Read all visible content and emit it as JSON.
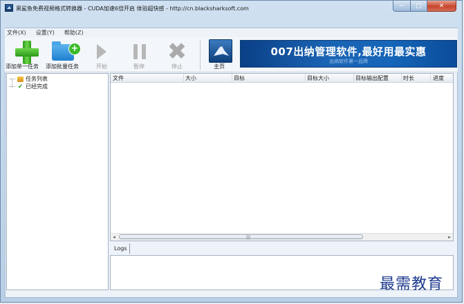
{
  "window": {
    "title": "黑鲨鱼免费视频格式转换器 - CUDA加速6倍开启 体验超快感 - http://cn.blacksharksoft.com",
    "buttons": {
      "minimize": "─",
      "maximize": "□",
      "close": "✕"
    }
  },
  "menu": {
    "items": [
      "文件(X)",
      "设置(Y)",
      "帮助(Z)"
    ]
  },
  "toolbar": {
    "add_single": "添加单一任务",
    "add_batch": "添加批量任务",
    "start": "开始",
    "pause": "暂停",
    "stop": "停止",
    "home": "主页"
  },
  "banner": {
    "main": "007出纳管理软件,最好用最实惠",
    "sub": "出纳软件第一品牌"
  },
  "tree": {
    "items": [
      "任务列表",
      "已经完成"
    ]
  },
  "list": {
    "columns": [
      "文件",
      "大小",
      "目标",
      "目标大小",
      "目标输出配置",
      "时长",
      "进度"
    ],
    "scroll_grip": "|||"
  },
  "logs": {
    "tab": "Logs"
  },
  "watermark": "最需教育",
  "colors": {
    "banner": "#1565b8",
    "accent_green": "#3cbb2a",
    "close_red": "#c8452c"
  }
}
